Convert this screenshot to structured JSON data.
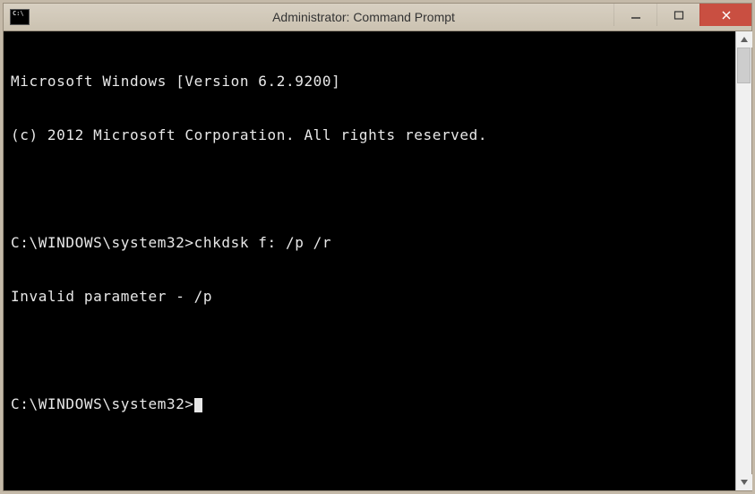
{
  "window": {
    "title": "Administrator: Command Prompt",
    "icon_text": "C:\\"
  },
  "terminal": {
    "lines": [
      "Microsoft Windows [Version 6.2.9200]",
      "(c) 2012 Microsoft Corporation. All rights reserved.",
      "",
      "C:\\WINDOWS\\system32>chkdsk f: /p /r",
      "Invalid parameter - /p",
      "",
      "C:\\WINDOWS\\system32>"
    ]
  }
}
